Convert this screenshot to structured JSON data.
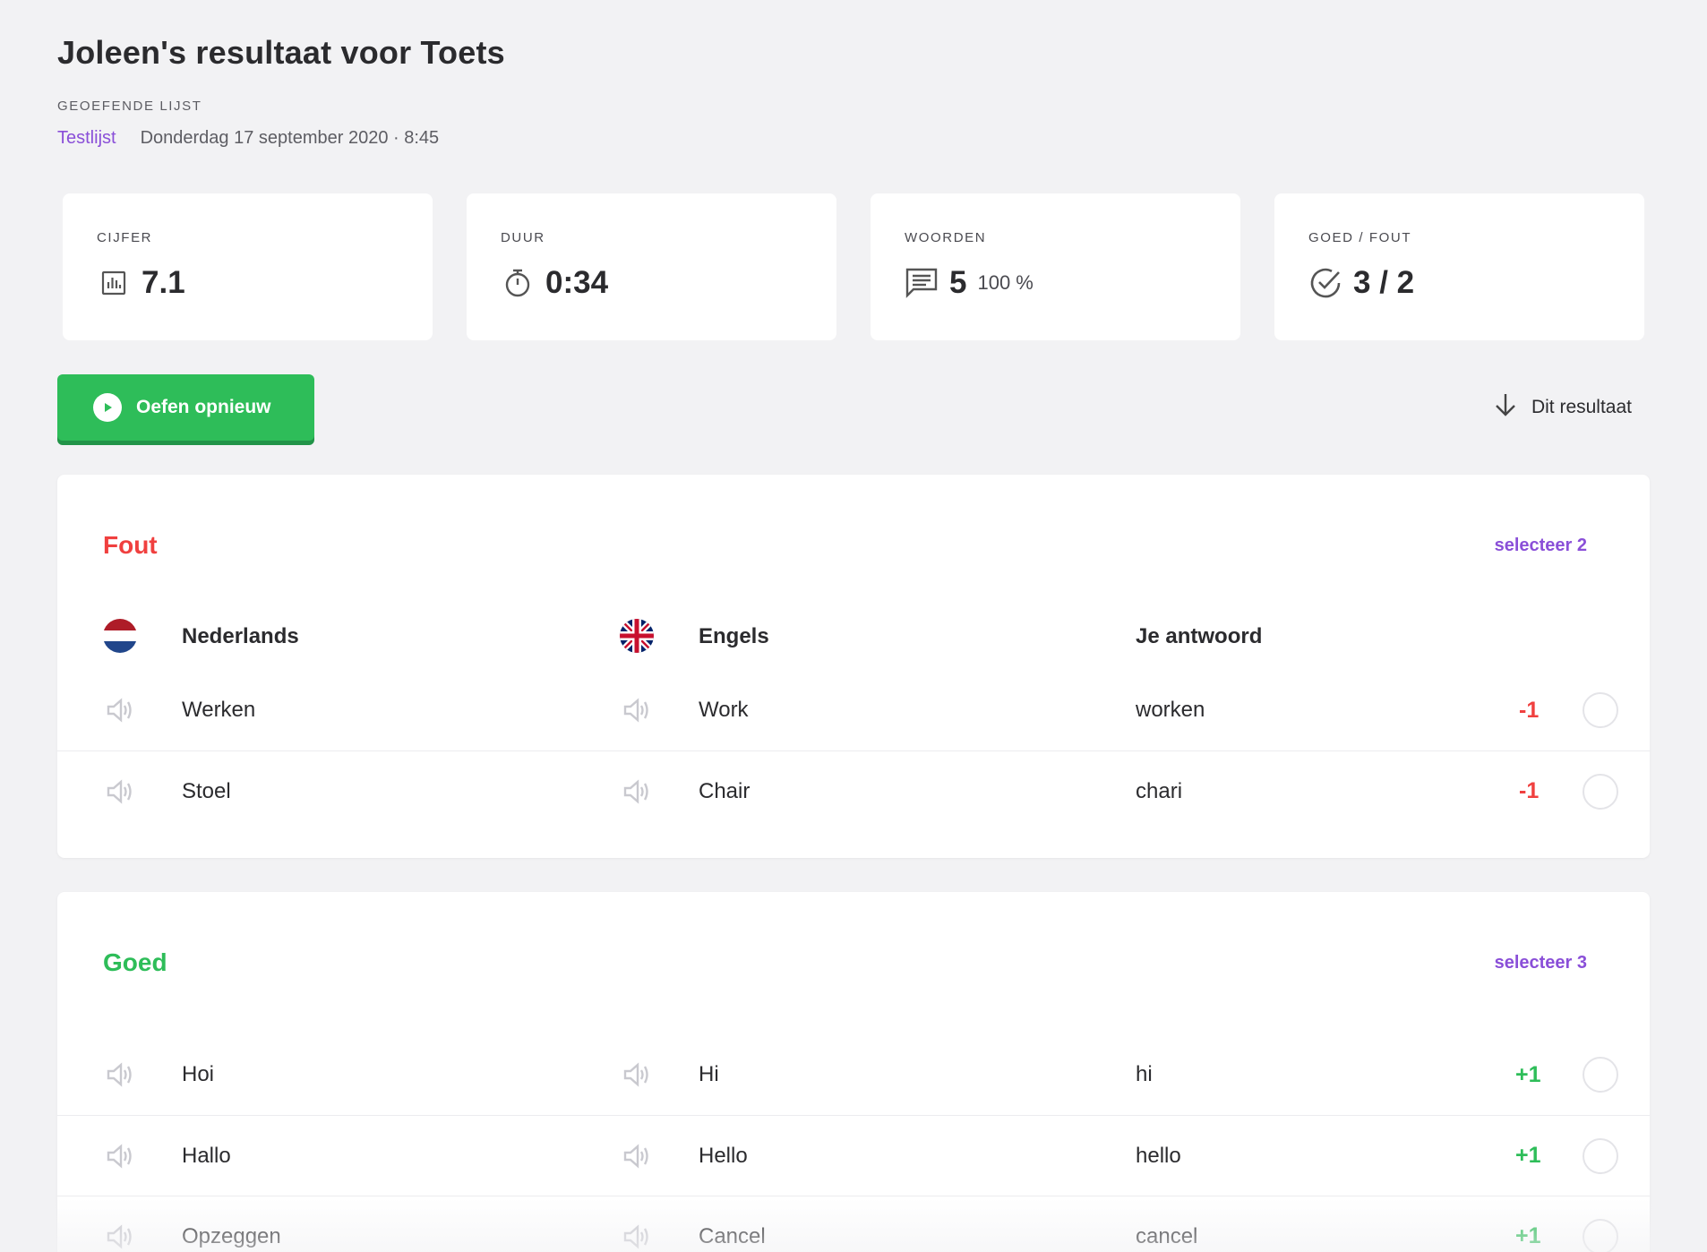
{
  "header": {
    "title": "Joleen's resultaat voor Toets",
    "section_label": "GEOEFENDE LIJST",
    "list_link": "Testlijst",
    "date": "Donderdag 17 september 2020 · 8:45"
  },
  "stats": [
    {
      "label": "CIJFER",
      "value": "7.1",
      "sub": "",
      "icon": "bar-chart-icon"
    },
    {
      "label": "DUUR",
      "value": "0:34",
      "sub": "",
      "icon": "stopwatch-icon"
    },
    {
      "label": "WOORDEN",
      "value": "5",
      "sub": "100 %",
      "icon": "chat-lines-icon"
    },
    {
      "label": "GOED / FOUT",
      "value": "3 / 2",
      "sub": "",
      "icon": "check-circle-icon"
    }
  ],
  "actions": {
    "practice_label": "Oefen opnieuw",
    "download_label": "Dit resultaat"
  },
  "colors": {
    "accent_purple": "#8a4fd8",
    "wrong_red": "#f0403f",
    "right_green": "#2ebd59"
  },
  "wrong": {
    "title": "Fout",
    "select_label": "selecteer 2",
    "columns": {
      "source": "Nederlands",
      "target": "Engels",
      "answer": "Je antwoord"
    },
    "rows": [
      {
        "source": "Werken",
        "target": "Work",
        "answer": "worken",
        "delta": "-1"
      },
      {
        "source": "Stoel",
        "target": "Chair",
        "answer": "chari",
        "delta": "-1"
      }
    ]
  },
  "right": {
    "title": "Goed",
    "select_label": "selecteer 3",
    "rows": [
      {
        "source": "Hoi",
        "target": "Hi",
        "answer": "hi",
        "delta": "+1"
      },
      {
        "source": "Hallo",
        "target": "Hello",
        "answer": "hello",
        "delta": "+1"
      },
      {
        "source": "Opzeggen",
        "target": "Cancel",
        "answer": "cancel",
        "delta": "+1"
      }
    ]
  }
}
